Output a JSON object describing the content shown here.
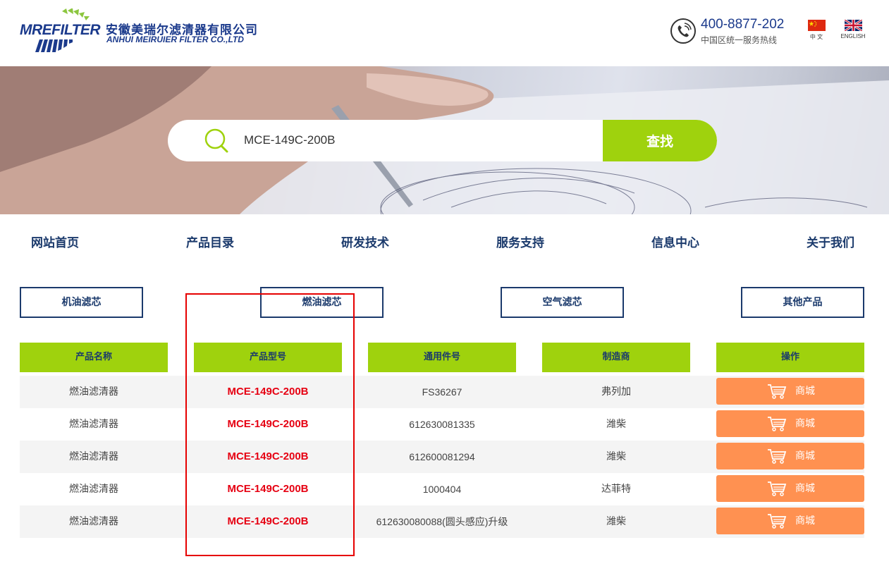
{
  "brand": {
    "wordmark": "MREFILTER",
    "name_cn": "安徽美瑞尔滤清器有限公司",
    "name_en": "ANHUI MEIRUIER FILTER CO.,LTD"
  },
  "hotline": {
    "number": "400-8877-202",
    "caption": "中国区统一服务热线"
  },
  "languages": [
    {
      "label": "中 文"
    },
    {
      "label": "ENGLISH"
    }
  ],
  "search": {
    "value": "MCE-149C-200B",
    "button_label": "查找"
  },
  "nav": [
    {
      "label": "网站首页"
    },
    {
      "label": "产品目录"
    },
    {
      "label": "研发技术"
    },
    {
      "label": "服务支持"
    },
    {
      "label": "信息中心"
    },
    {
      "label": "关于我们"
    }
  ],
  "categories": [
    {
      "label": "机油滤芯"
    },
    {
      "label": "燃油滤芯"
    },
    {
      "label": "空气滤芯"
    },
    {
      "label": "其他产品"
    }
  ],
  "table": {
    "columns": [
      "产品名称",
      "产品型号",
      "通用件号",
      "制造商",
      "操作"
    ],
    "rows": [
      {
        "name": "燃油滤清器",
        "model": "MCE-149C-200B",
        "common_no": "FS36267",
        "maker": "弗列加",
        "action": "商城"
      },
      {
        "name": "燃油滤清器",
        "model": "MCE-149C-200B",
        "common_no": "612630081335",
        "maker": "潍柴",
        "action": "商城"
      },
      {
        "name": "燃油滤清器",
        "model": "MCE-149C-200B",
        "common_no": "612600081294",
        "maker": "潍柴",
        "action": "商城"
      },
      {
        "name": "燃油滤清器",
        "model": "MCE-149C-200B",
        "common_no": "1000404",
        "maker": "达菲特",
        "action": "商城"
      },
      {
        "name": "燃油滤清器",
        "model": "MCE-149C-200B",
        "common_no": "612630080088(圆头感应)升级",
        "maker": "潍柴",
        "action": "商城"
      }
    ]
  },
  "colors": {
    "brand_blue": "#1b3a8c",
    "nav_blue": "#1b3a6c",
    "accent_green": "#9fd20d",
    "shop_orange": "#ff9151",
    "model_red": "#e60012",
    "highlight_red": "#e60000"
  }
}
